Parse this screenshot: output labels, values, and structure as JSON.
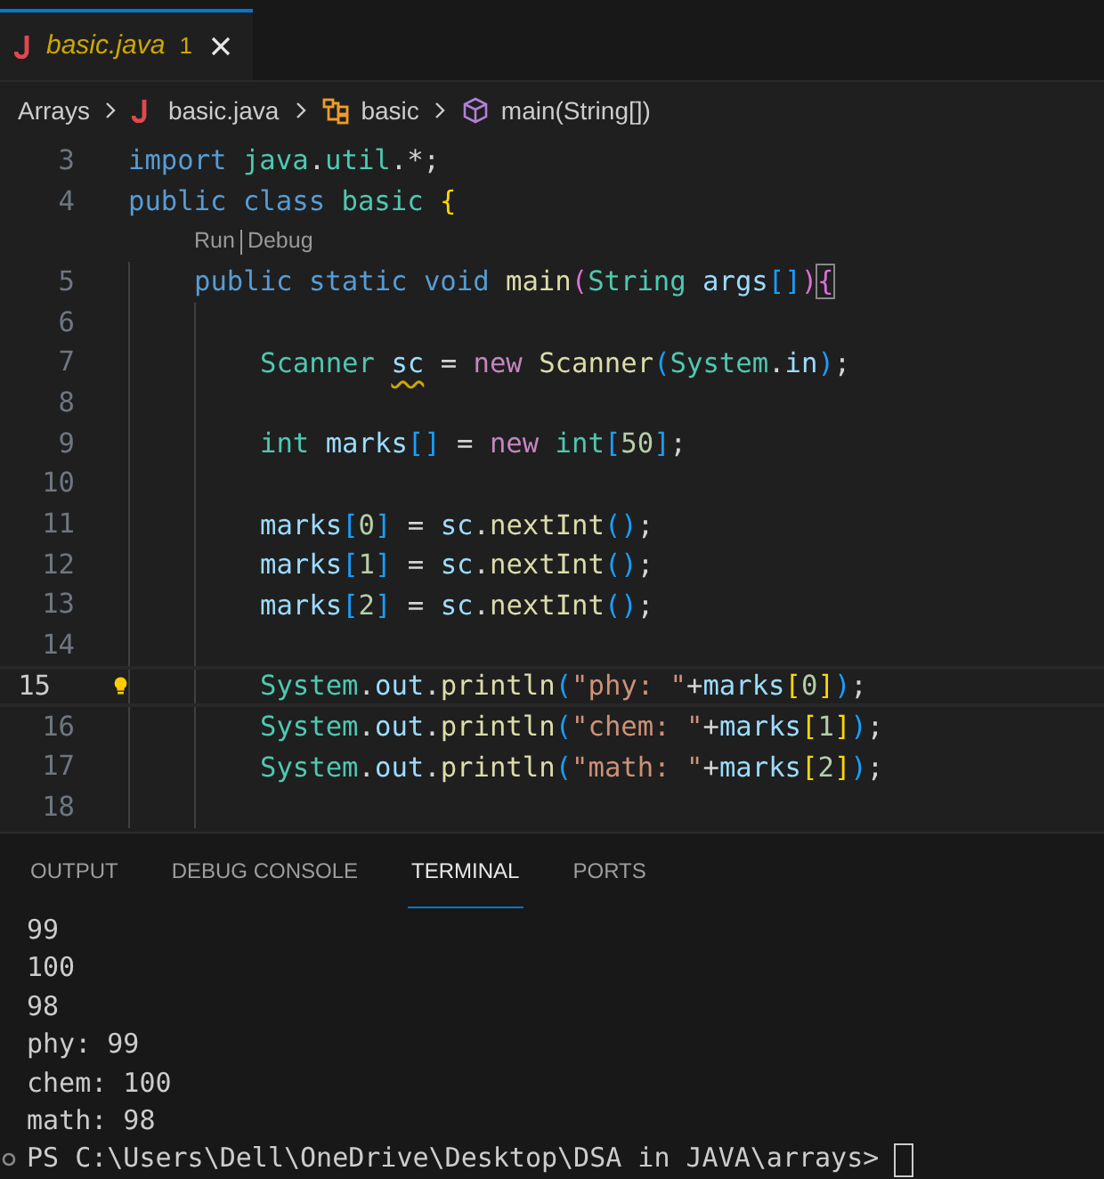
{
  "tab": {
    "label": "basic.java",
    "problems": "1",
    "selected": true
  },
  "breadcrumbs": [
    {
      "label": "Arrays",
      "kind": "folder"
    },
    {
      "label": "basic.java",
      "kind": "file"
    },
    {
      "label": "basic",
      "kind": "class"
    },
    {
      "label": "main(String[])",
      "kind": "method"
    }
  ],
  "code": [
    {
      "number": "3",
      "tokens": [
        {
          "text": "import",
          "kind": "keyword"
        },
        {
          "text": " java",
          "kind": "type"
        },
        {
          "text": ".",
          "kind": "plain"
        },
        {
          "text": "util",
          "kind": "type"
        },
        {
          "text": ".*;",
          "kind": "plain"
        }
      ]
    },
    {
      "number": "4",
      "tokens": [
        {
          "text": "public",
          "kind": "keyword"
        },
        {
          "text": " class",
          "kind": "keyword"
        },
        {
          "text": " basic",
          "kind": "type"
        },
        {
          "text": " {",
          "kind": "bracket1"
        }
      ],
      "children": [
        {
          "kind": "codelens",
          "links": [
            "Run",
            "Debug"
          ]
        },
        {
          "number": "5",
          "tokens": [
            {
              "text": "public",
              "kind": "keyword"
            },
            {
              "text": " static",
              "kind": "keyword"
            },
            {
              "text": " void",
              "kind": "keyword"
            },
            {
              "text": " main",
              "kind": "function"
            },
            {
              "text": "(",
              "kind": "bracket2"
            },
            {
              "text": "String",
              "kind": "type"
            },
            {
              "text": " args",
              "kind": "variable"
            },
            {
              "text": "[]",
              "kind": "bracket3"
            },
            {
              "text": ")",
              "kind": "bracket2"
            },
            {
              "text": "{",
              "kind": "bracket2",
              "matched": true
            }
          ],
          "children": [
            {
              "number": "6"
            },
            {
              "number": "7",
              "tokens": [
                {
                  "text": "Scanner ",
                  "kind": "type"
                },
                {
                  "text": "sc",
                  "kind": "variable",
                  "squiggle": true
                },
                {
                  "text": " =",
                  "kind": "plain"
                },
                {
                  "text": " new",
                  "kind": "control"
                },
                {
                  "text": " Scanner",
                  "kind": "function"
                },
                {
                  "text": "(",
                  "kind": "bracket3"
                },
                {
                  "text": "System",
                  "kind": "type"
                },
                {
                  "text": ".",
                  "kind": "plain"
                },
                {
                  "text": "in",
                  "kind": "variable"
                },
                {
                  "text": ")",
                  "kind": "bracket3"
                },
                {
                  "text": ";",
                  "kind": "plain"
                }
              ]
            },
            {
              "number": "8"
            },
            {
              "number": "9",
              "tokens": [
                {
                  "text": "int",
                  "kind": "type"
                },
                {
                  "text": " marks",
                  "kind": "variable"
                },
                {
                  "text": "[]",
                  "kind": "bracket3"
                },
                {
                  "text": " =",
                  "kind": "plain"
                },
                {
                  "text": " new",
                  "kind": "control"
                },
                {
                  "text": " int",
                  "kind": "type"
                },
                {
                  "text": "[",
                  "kind": "bracket3"
                },
                {
                  "text": "50",
                  "kind": "number"
                },
                {
                  "text": "]",
                  "kind": "bracket3"
                },
                {
                  "text": ";",
                  "kind": "plain"
                }
              ]
            },
            {
              "number": "10"
            },
            {
              "number": "11",
              "tokens": [
                {
                  "text": "marks",
                  "kind": "variable"
                },
                {
                  "text": "[",
                  "kind": "bracket3"
                },
                {
                  "text": "0",
                  "kind": "number"
                },
                {
                  "text": "]",
                  "kind": "bracket3"
                },
                {
                  "text": " =",
                  "kind": "plain"
                },
                {
                  "text": " sc",
                  "kind": "variable"
                },
                {
                  "text": ".",
                  "kind": "plain"
                },
                {
                  "text": "nextInt",
                  "kind": "function"
                },
                {
                  "text": "()",
                  "kind": "bracket3"
                },
                {
                  "text": ";",
                  "kind": "plain"
                }
              ]
            },
            {
              "number": "12",
              "tokens": [
                {
                  "text": "marks",
                  "kind": "variable"
                },
                {
                  "text": "[",
                  "kind": "bracket3"
                },
                {
                  "text": "1",
                  "kind": "number"
                },
                {
                  "text": "]",
                  "kind": "bracket3"
                },
                {
                  "text": " =",
                  "kind": "plain"
                },
                {
                  "text": " sc",
                  "kind": "variable"
                },
                {
                  "text": ".",
                  "kind": "plain"
                },
                {
                  "text": "nextInt",
                  "kind": "function"
                },
                {
                  "text": "()",
                  "kind": "bracket3"
                },
                {
                  "text": ";",
                  "kind": "plain"
                }
              ]
            },
            {
              "number": "13",
              "tokens": [
                {
                  "text": "marks",
                  "kind": "variable"
                },
                {
                  "text": "[",
                  "kind": "bracket3"
                },
                {
                  "text": "2",
                  "kind": "number"
                },
                {
                  "text": "]",
                  "kind": "bracket3"
                },
                {
                  "text": " =",
                  "kind": "plain"
                },
                {
                  "text": " sc",
                  "kind": "variable"
                },
                {
                  "text": ".",
                  "kind": "plain"
                },
                {
                  "text": "nextInt",
                  "kind": "function"
                },
                {
                  "text": "()",
                  "kind": "bracket3"
                },
                {
                  "text": ";",
                  "kind": "plain"
                }
              ]
            },
            {
              "number": "14"
            },
            {
              "number": "15",
              "current": true,
              "lightbulb": true,
              "tokens": [
                {
                  "text": "System",
                  "kind": "type"
                },
                {
                  "text": ".",
                  "kind": "plain"
                },
                {
                  "text": "out",
                  "kind": "variable"
                },
                {
                  "text": ".",
                  "kind": "plain"
                },
                {
                  "text": "println",
                  "kind": "function"
                },
                {
                  "text": "(",
                  "kind": "bracket3"
                },
                {
                  "text": "\"phy: \"",
                  "kind": "string"
                },
                {
                  "text": "+",
                  "kind": "plain"
                },
                {
                  "text": "marks",
                  "kind": "variable"
                },
                {
                  "text": "[",
                  "kind": "bracket1"
                },
                {
                  "text": "0",
                  "kind": "number"
                },
                {
                  "text": "]",
                  "kind": "bracket1"
                },
                {
                  "text": ")",
                  "kind": "bracket3"
                },
                {
                  "text": ";",
                  "kind": "plain"
                }
              ]
            },
            {
              "number": "16",
              "tokens": [
                {
                  "text": "System",
                  "kind": "type"
                },
                {
                  "text": ".",
                  "kind": "plain"
                },
                {
                  "text": "out",
                  "kind": "variable"
                },
                {
                  "text": ".",
                  "kind": "plain"
                },
                {
                  "text": "println",
                  "kind": "function"
                },
                {
                  "text": "(",
                  "kind": "bracket3"
                },
                {
                  "text": "\"chem: \"",
                  "kind": "string"
                },
                {
                  "text": "+",
                  "kind": "plain"
                },
                {
                  "text": "marks",
                  "kind": "variable"
                },
                {
                  "text": "[",
                  "kind": "bracket1"
                },
                {
                  "text": "1",
                  "kind": "number"
                },
                {
                  "text": "]",
                  "kind": "bracket1"
                },
                {
                  "text": ")",
                  "kind": "bracket3"
                },
                {
                  "text": ";",
                  "kind": "plain"
                }
              ]
            },
            {
              "number": "17",
              "tokens": [
                {
                  "text": "System",
                  "kind": "type"
                },
                {
                  "text": ".",
                  "kind": "plain"
                },
                {
                  "text": "out",
                  "kind": "variable"
                },
                {
                  "text": ".",
                  "kind": "plain"
                },
                {
                  "text": "println",
                  "kind": "function"
                },
                {
                  "text": "(",
                  "kind": "bracket3"
                },
                {
                  "text": "\"math: \"",
                  "kind": "string"
                },
                {
                  "text": "+",
                  "kind": "plain"
                },
                {
                  "text": "marks",
                  "kind": "variable"
                },
                {
                  "text": "[",
                  "kind": "bracket1"
                },
                {
                  "text": "2",
                  "kind": "number"
                },
                {
                  "text": "]",
                  "kind": "bracket1"
                },
                {
                  "text": ")",
                  "kind": "bracket3"
                },
                {
                  "text": ";",
                  "kind": "plain"
                }
              ]
            },
            {
              "number": "18"
            }
          ]
        }
      ]
    }
  ],
  "panel_tabs": [
    {
      "label": "OUTPUT",
      "selected": false
    },
    {
      "label": "DEBUG CONSOLE",
      "selected": false
    },
    {
      "label": "TERMINAL",
      "selected": true
    },
    {
      "label": "PORTS",
      "selected": false
    }
  ],
  "terminal": {
    "lines": [
      "99",
      "100",
      "98",
      "phy: 99",
      "chem: 100",
      "math: 98"
    ],
    "prompt": "PS C:\\Users\\Dell\\OneDrive\\Desktop\\DSA in JAVA\\arrays>"
  }
}
